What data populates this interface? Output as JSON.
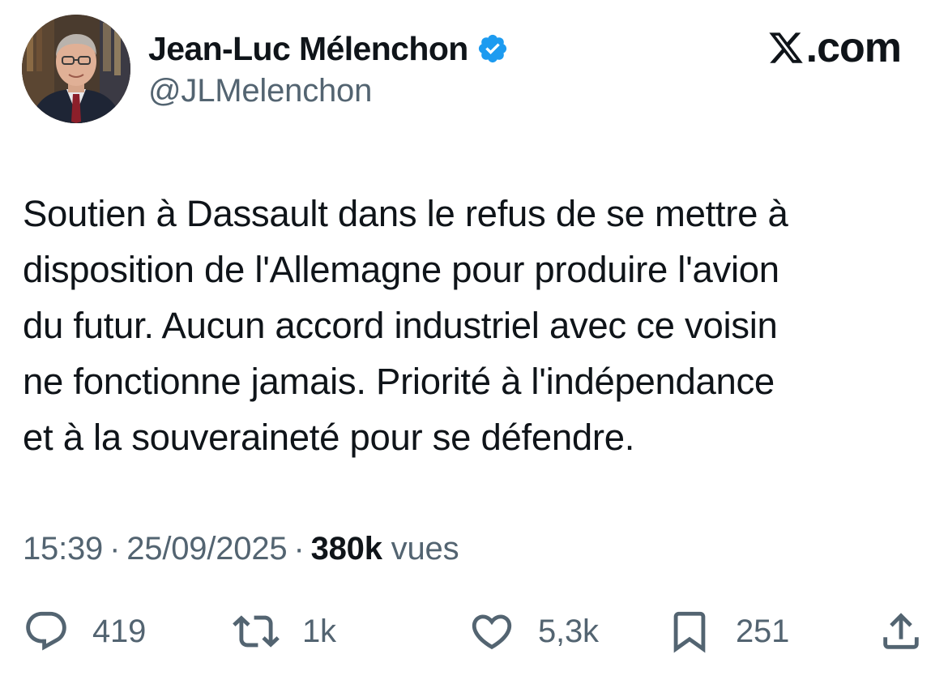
{
  "author": {
    "name": "Jean-Luc Mélenchon",
    "handle": "@JLMelenchon",
    "verified": true,
    "avatar_icon": "avatar-photo"
  },
  "brand": {
    "domain": ".com",
    "logo_icon": "x-logo-icon"
  },
  "tweet": {
    "lines": [
      "Soutien à Dassault dans le refus de se mettre à",
      "disposition de l'Allemagne pour produire l'avion",
      "du futur. Aucun accord industriel avec ce voisin",
      "ne fonctionne jamais. Priorité à l'indépendance",
      "et à la souveraineté pour se défendre."
    ]
  },
  "meta": {
    "time": "15:39",
    "date": "25/09/2025",
    "separator": "·",
    "views_count": "380k",
    "views_label": "vues"
  },
  "actions": {
    "reply": {
      "icon": "reply-icon",
      "count": "419"
    },
    "repost": {
      "icon": "repost-icon",
      "count": "1k"
    },
    "like": {
      "icon": "heart-icon",
      "count": "5,3k"
    },
    "bookmark": {
      "icon": "bookmark-icon",
      "count": "251"
    },
    "share": {
      "icon": "share-icon"
    }
  },
  "colors": {
    "text_primary": "#0f1419",
    "text_secondary": "#536471",
    "verified_blue": "#1d9bf0"
  }
}
